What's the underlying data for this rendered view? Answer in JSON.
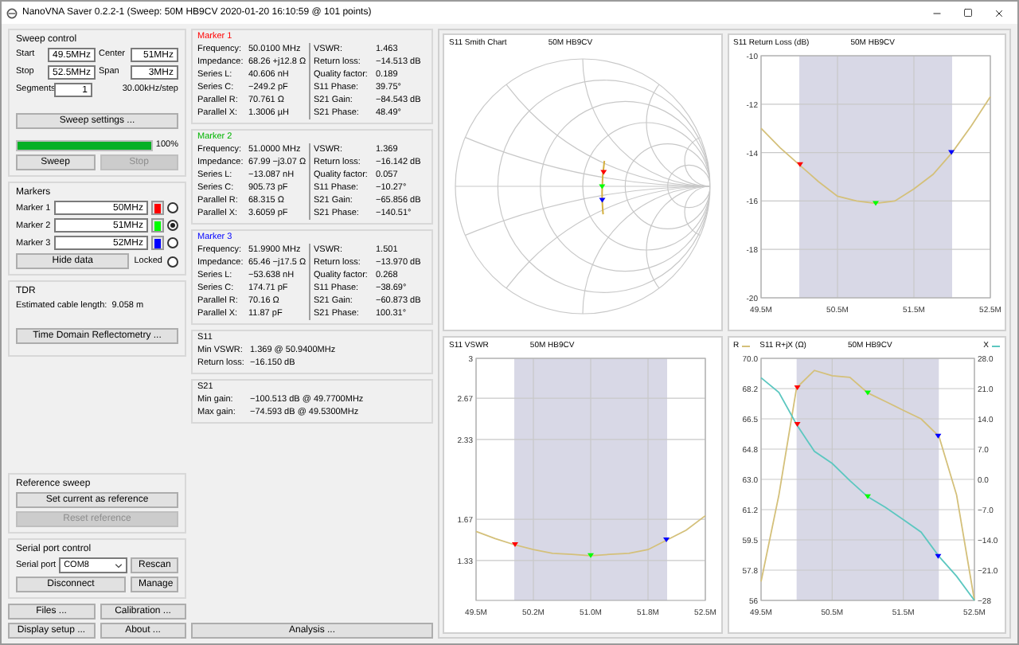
{
  "window": {
    "title": "NanoVNA Saver 0.2.2-1 (Sweep: 50M HB9CV 2020-01-20 16:10:59 @ 101 points)"
  },
  "sweep_control": {
    "title": "Sweep control",
    "fields": [
      {
        "label": "Start",
        "value": "49.5MHz"
      },
      {
        "label": "Center",
        "value": "51MHz"
      },
      {
        "label": "Stop",
        "value": "52.5MHz"
      },
      {
        "label": "Span",
        "value": "3MHz"
      }
    ],
    "segments": {
      "label": "Segments",
      "value": "1"
    },
    "step": "30.00kHz/step",
    "settings_button": "Sweep settings ...",
    "progress": {
      "level": 1,
      "reading": "100%"
    },
    "buttons": [
      {
        "label": "Sweep",
        "disabled": false
      },
      {
        "label": "Stop",
        "disabled": true
      }
    ]
  },
  "markers_panel": {
    "title": "Markers",
    "markers": [
      {
        "label": "Marker 1",
        "value": "50MHz",
        "color": "#ff0000",
        "selected": false
      },
      {
        "label": "Marker 2",
        "value": "51MHz",
        "color": "#00ff00",
        "selected": true
      },
      {
        "label": "Marker 3",
        "value": "52MHz",
        "color": "#0000ff",
        "selected": false
      }
    ],
    "hide_button": "Hide data",
    "locked": {
      "label": "Locked",
      "checked": false
    }
  },
  "tdr": {
    "title": "TDR",
    "label": "Estimated cable length:",
    "value": "9.058 m",
    "button": "Time Domain Reflectometry ..."
  },
  "reference_sweep": {
    "title": "Reference sweep",
    "buttons": [
      {
        "label": "Set current as reference",
        "disabled": false
      },
      {
        "label": "Reset reference",
        "disabled": true
      }
    ]
  },
  "serial_port": {
    "title": "Serial port control",
    "label": "Serial port",
    "value": "COM8",
    "buttons": [
      "Rescan",
      "Disconnect",
      "Manage"
    ]
  },
  "bottom_buttons": [
    "Files ...",
    "Calibration ...",
    "Display setup ...",
    "About ..."
  ],
  "marker_data": [
    {
      "title": "Marker 1",
      "color": "#ff0000",
      "left": [
        {
          "label": "Frequency:",
          "value": "50.0100 MHz"
        },
        {
          "label": "Impedance:",
          "value": "68.26 +j12.8 Ω"
        },
        {
          "label": "Series L:",
          "value": "40.606 nH"
        },
        {
          "label": "Series C:",
          "value": "−249.2 pF"
        },
        {
          "label": "Parallel R:",
          "value": "70.761 Ω"
        },
        {
          "label": "Parallel X:",
          "value": "1.3006 µH"
        }
      ],
      "right": [
        {
          "label": "VSWR:",
          "value": "1.463"
        },
        {
          "label": "Return loss:",
          "value": "−14.513 dB"
        },
        {
          "label": "Quality factor:",
          "value": "0.189"
        },
        {
          "label": "S11 Phase:",
          "value": "39.75°"
        },
        {
          "label": "S21 Gain:",
          "value": "−84.543 dB"
        },
        {
          "label": "S21 Phase:",
          "value": "48.49°"
        }
      ]
    },
    {
      "title": "Marker 2",
      "color": "#00b400",
      "left": [
        {
          "label": "Frequency:",
          "value": "51.0000 MHz"
        },
        {
          "label": "Impedance:",
          "value": "67.99 −j3.07 Ω"
        },
        {
          "label": "Series L:",
          "value": "−13.087 nH"
        },
        {
          "label": "Series C:",
          "value": "905.73 pF"
        },
        {
          "label": "Parallel R:",
          "value": "68.315 Ω"
        },
        {
          "label": "Parallel X:",
          "value": "3.6059 pF"
        }
      ],
      "right": [
        {
          "label": "VSWR:",
          "value": "1.369"
        },
        {
          "label": "Return loss:",
          "value": "−16.142 dB"
        },
        {
          "label": "Quality factor:",
          "value": "0.057"
        },
        {
          "label": "S11 Phase:",
          "value": "−10.27°"
        },
        {
          "label": "S21 Gain:",
          "value": "−65.856 dB"
        },
        {
          "label": "S21 Phase:",
          "value": "−140.51°"
        }
      ]
    },
    {
      "title": "Marker 3",
      "color": "#0000ff",
      "left": [
        {
          "label": "Frequency:",
          "value": "51.9900 MHz"
        },
        {
          "label": "Impedance:",
          "value": "65.46 −j17.5 Ω"
        },
        {
          "label": "Series L:",
          "value": "−53.638 nH"
        },
        {
          "label": "Series C:",
          "value": "174.71 pF"
        },
        {
          "label": "Parallel R:",
          "value": "70.16 Ω"
        },
        {
          "label": "Parallel X:",
          "value": "11.87 pF"
        }
      ],
      "right": [
        {
          "label": "VSWR:",
          "value": "1.501"
        },
        {
          "label": "Return loss:",
          "value": "−13.970 dB"
        },
        {
          "label": "Quality factor:",
          "value": "0.268"
        },
        {
          "label": "S11 Phase:",
          "value": "−38.69°"
        },
        {
          "label": "S21 Gain:",
          "value": "−60.873 dB"
        },
        {
          "label": "S21 Phase:",
          "value": "100.31°"
        }
      ]
    }
  ],
  "s11": {
    "title": "S11",
    "rows": [
      {
        "label": "Min VSWR:",
        "value": "1.369 @ 50.9400MHz"
      },
      {
        "label": "Return loss:",
        "value": "−16.150 dB"
      }
    ]
  },
  "s21": {
    "title": "S21",
    "rows": [
      {
        "label": "Min gain:",
        "value": "−100.513 dB @ 49.7700MHz"
      },
      {
        "label": "Max gain:",
        "value": "−74.593 dB @ 49.5300MHz"
      }
    ]
  },
  "analysis_button": "Analysis ...",
  "charts": [
    {
      "kind": "smith",
      "title": "S11 Smith Chart",
      "subtitle": "50M HB9CV"
    },
    {
      "kind": "line",
      "title": "S11 Return Loss (dB)",
      "subtitle": "50M HB9CV",
      "chart_data": {
        "type": "line",
        "x": [
          49.5,
          49.75,
          50,
          50.25,
          50.5,
          50.75,
          51,
          51.25,
          51.5,
          51.75,
          52,
          52.25,
          52.5
        ],
        "series": [
          {
            "color": "#d4c07a",
            "values": [
              -13.0,
              -13.8,
              -14.5,
              -15.2,
              -15.8,
              -16.0,
              -16.1,
              -16.0,
              -15.5,
              -14.9,
              -14.0,
              -12.9,
              -11.7
            ]
          },
          {
            "type": "scatter",
            "color": "#ff0000",
            "x": [
              50.01
            ],
            "values": [
              -14.5
            ]
          },
          {
            "type": "scatter",
            "color": "#00ff00",
            "x": [
              51
            ],
            "values": [
              -16.1
            ]
          },
          {
            "type": "scatter",
            "color": "#0000ff",
            "x": [
              51.99
            ],
            "values": [
              -14.0
            ]
          }
        ],
        "grid": true,
        "bands": [
          {
            "axis": "x",
            "from": 50,
            "to": 52
          }
        ],
        "xlim": [
          49.5,
          52.5
        ],
        "ylim": [
          -20,
          -10
        ],
        "xticks": [
          {
            "value": 49.5,
            "label": "49.5M"
          },
          {
            "value": 50.5,
            "label": "50.5M"
          },
          {
            "value": 51.5,
            "label": "51.5M"
          },
          {
            "value": 52.5,
            "label": "52.5M"
          }
        ],
        "yticks": [
          -10,
          -12,
          -14,
          -16,
          -18,
          -20
        ]
      }
    },
    {
      "kind": "line",
      "title": "S11 VSWR",
      "subtitle": "50M HB9CV",
      "chart_data": {
        "type": "line",
        "x": [
          49.5,
          49.75,
          50,
          50.25,
          50.5,
          50.75,
          51,
          51.25,
          51.5,
          51.75,
          52,
          52.25,
          52.5
        ],
        "series": [
          {
            "color": "#d4c07a",
            "values": [
              1.57,
              1.51,
              1.46,
              1.42,
              1.39,
              1.38,
              1.37,
              1.38,
              1.39,
              1.42,
              1.5,
              1.58,
              1.7
            ]
          },
          {
            "type": "scatter",
            "color": "#ff0000",
            "x": [
              50.01
            ],
            "values": [
              1.46
            ]
          },
          {
            "type": "scatter",
            "color": "#00ff00",
            "x": [
              51
            ],
            "values": [
              1.37
            ]
          },
          {
            "type": "scatter",
            "color": "#0000ff",
            "x": [
              51.99
            ],
            "values": [
              1.5
            ]
          }
        ],
        "grid": true,
        "bands": [
          {
            "axis": "x",
            "from": 50,
            "to": 52
          }
        ],
        "xlim": [
          49.5,
          52.5
        ],
        "ylim": [
          1,
          3
        ],
        "xticks": [
          {
            "value": 49.5,
            "label": "49.5M"
          },
          {
            "value": 50.25,
            "label": "50.2M"
          },
          {
            "value": 51,
            "label": "51.0M"
          },
          {
            "value": 51.75,
            "label": "51.8M"
          },
          {
            "value": 52.5,
            "label": "52.5M"
          }
        ],
        "yticks": [
          {
            "value": 3,
            "label": "3"
          },
          {
            "value": 2.67,
            "label": "2.67"
          },
          {
            "value": 2.33,
            "label": "2.33"
          },
          {
            "value": 1.67,
            "label": "1.67"
          },
          {
            "value": 1.33,
            "label": "1.33"
          }
        ]
      }
    },
    {
      "kind": "line",
      "title": "S11 R+jX (Ω)",
      "subtitle": "50M HB9CV",
      "chart_data": {
        "type": "line",
        "x": [
          49.5,
          49.75,
          50,
          50.25,
          50.5,
          50.75,
          51,
          51.25,
          51.5,
          51.75,
          52,
          52.25,
          52.5
        ],
        "series": [
          {
            "name": "R",
            "color": "#d4c07a",
            "values": [
              57.1,
              62.1,
              68.3,
              69.3,
              69.0,
              68.9,
              68.0,
              67.5,
              67.0,
              66.5,
              65.5,
              62.1,
              56
            ]
          },
          {
            "name": "X",
            "color": "#5cc7c0",
            "axis": "y2",
            "values": [
              23.5,
              20.1,
              12.7,
              6.5,
              3.7,
              -0.3,
              -4.0,
              -6.5,
              -9.3,
              -12.2,
              -17.8,
              -22.4,
              -28
            ]
          },
          {
            "type": "scatter",
            "color": "#ff0000",
            "x": [
              50.01
            ],
            "values": [
              68.3
            ]
          },
          {
            "type": "scatter",
            "color": "#00ff00",
            "x": [
              51
            ],
            "values": [
              68.0
            ]
          },
          {
            "type": "scatter",
            "color": "#0000ff",
            "x": [
              51.99
            ],
            "values": [
              65.5
            ]
          },
          {
            "type": "scatter",
            "color": "#ff0000",
            "axis": "y2",
            "x": [
              50.01
            ],
            "values": [
              12.7
            ]
          },
          {
            "type": "scatter",
            "color": "#00ff00",
            "axis": "y2",
            "x": [
              51
            ],
            "values": [
              -4.0
            ]
          },
          {
            "type": "scatter",
            "color": "#0000ff",
            "axis": "y2",
            "x": [
              51.99
            ],
            "values": [
              -17.8
            ]
          }
        ],
        "grid": true,
        "bands": [
          {
            "axis": "x",
            "from": 50,
            "to": 52
          }
        ],
        "xlim": [
          49.5,
          52.5
        ],
        "ylim": [
          56,
          70
        ],
        "y2lim": [
          -28,
          28
        ],
        "xticks": [
          {
            "value": 49.5,
            "label": "49.5M"
          },
          {
            "value": 50.5,
            "label": "50.5M"
          },
          {
            "value": 51.5,
            "label": "51.5M"
          },
          {
            "value": 52.5,
            "label": "52.5M"
          }
        ],
        "yticks": [
          {
            "value": 70,
            "label": "70.0"
          },
          {
            "value": 68.25,
            "label": "68.2"
          },
          {
            "value": 66.5,
            "label": "66.5"
          },
          {
            "value": 64.75,
            "label": "64.8"
          },
          {
            "value": 63,
            "label": "63.0"
          },
          {
            "value": 61.25,
            "label": "61.2"
          },
          {
            "value": 59.5,
            "label": "59.5"
          },
          {
            "value": 57.75,
            "label": "57.8"
          },
          {
            "value": 56,
            "label": "56"
          }
        ],
        "y2ticks": [
          {
            "value": 28,
            "label": "28.0"
          },
          {
            "value": 21,
            "label": "21.0"
          },
          {
            "value": 14,
            "label": "14.0"
          },
          {
            "value": 7,
            "label": "7.0"
          },
          {
            "value": 0,
            "label": "0.0"
          },
          {
            "value": -7,
            "label": "−7.0"
          },
          {
            "value": -14,
            "label": "−14.0"
          },
          {
            "value": -21,
            "label": "−21.0"
          },
          {
            "value": -28,
            "label": "−28"
          }
        ]
      }
    }
  ]
}
